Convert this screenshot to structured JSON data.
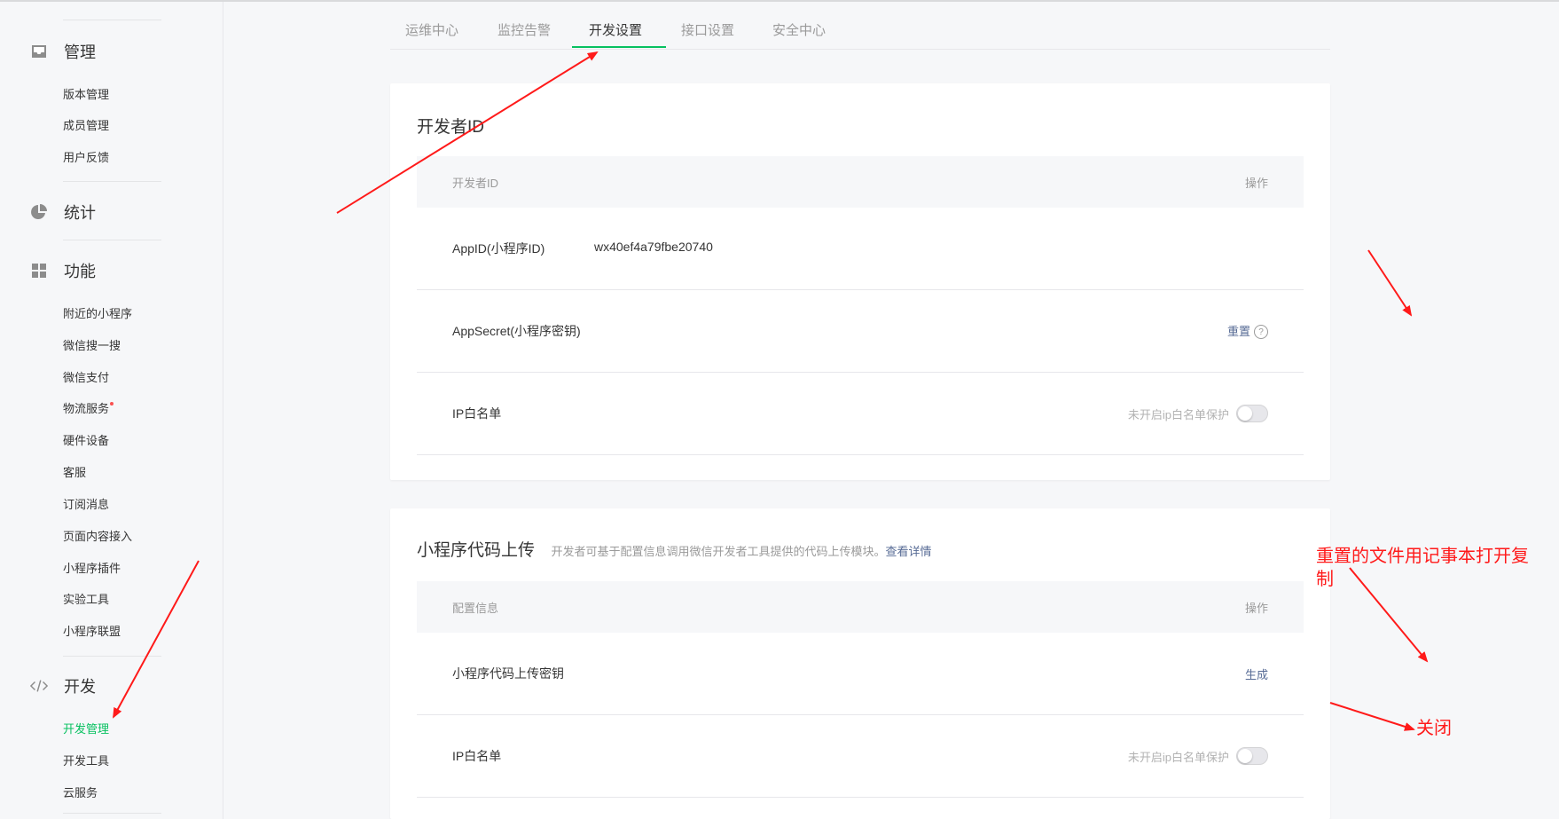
{
  "sidebar": {
    "sections": [
      {
        "title": "管理",
        "icon": "inbox-icon",
        "items": [
          "版本管理",
          "成员管理",
          "用户反馈"
        ]
      },
      {
        "title": "统计",
        "icon": "pie-chart-icon",
        "items": []
      },
      {
        "title": "功能",
        "icon": "grid-icon",
        "items": [
          "附近的小程序",
          "微信搜一搜",
          "微信支付",
          "物流服务",
          "硬件设备",
          "客服",
          "订阅消息",
          "页面内容接入",
          "小程序插件",
          "实验工具",
          "小程序联盟"
        ]
      },
      {
        "title": "开发",
        "icon": "code-icon",
        "items": [
          "开发管理",
          "开发工具",
          "云服务"
        ]
      }
    ],
    "active_item": "开发管理"
  },
  "tabs": [
    "运维中心",
    "监控告警",
    "开发设置",
    "接口设置",
    "安全中心"
  ],
  "active_tab": "开发设置",
  "developer_id": {
    "title": "开发者ID",
    "header": {
      "col1": "开发者ID",
      "col2": "操作"
    },
    "appid_label": "AppID(小程序ID)",
    "appid_value": "wx40ef4a79fbe20740",
    "secret_label": "AppSecret(小程序密钥)",
    "reset_label": "重置",
    "help_label": "?",
    "ip_label": "IP白名单",
    "ip_status": "未开启ip白名单保护"
  },
  "code_upload": {
    "title": "小程序代码上传",
    "desc": "开发者可基于配置信息调用微信开发者工具提供的代码上传模块。",
    "more_link": "查看详情",
    "header": {
      "col1": "配置信息",
      "col2": "操作"
    },
    "key_label": "小程序代码上传密钥",
    "generate_label": "生成",
    "ip_label": "IP白名单",
    "ip_status": "未开启ip白名单保护"
  },
  "annotations": {
    "note1_line1": "重置的文件用记事本打开复",
    "note1_line2": "制",
    "note2": "关闭"
  },
  "colors": {
    "accent": "#07c160",
    "link": "#576b95",
    "annotation": "#ff1a1a"
  }
}
